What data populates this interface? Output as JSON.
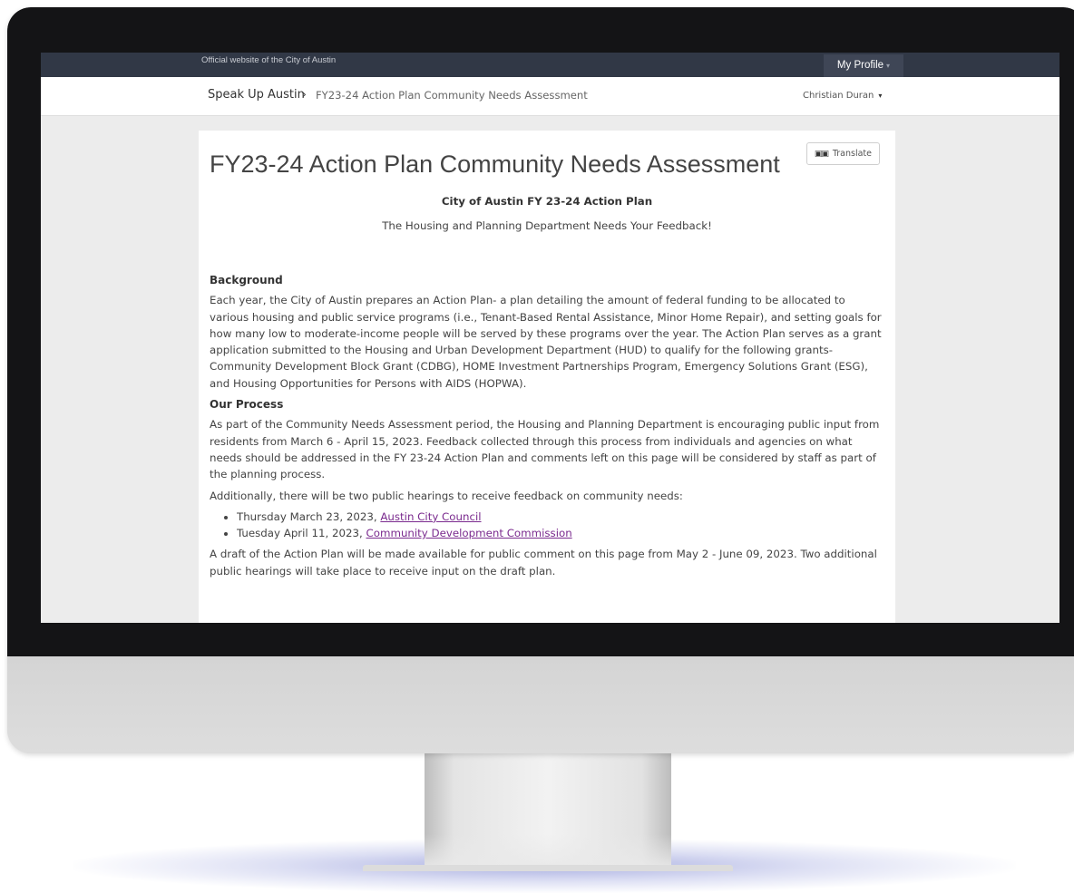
{
  "topbar": {
    "official_text": "Official website of the City of Austin",
    "profile_label": "My Profile",
    "profile_caret": "▾"
  },
  "nav": {
    "breadcrumb_home": "Speak Up Austin",
    "breadcrumb_separator": "›",
    "breadcrumb_current": "FY23-24 Action Plan Community Needs Assessment",
    "user_name": "Christian Duran",
    "user_caret": "▾"
  },
  "page": {
    "translate_icon": "▣▣",
    "translate_label": "Translate",
    "title": "FY23-24 Action Plan Community Needs Assessment",
    "subtitle": "City of Austin FY 23-24 Action Plan",
    "tagline": "The Housing and Planning Department Needs Your Feedback!",
    "background_heading": "Background",
    "background_text": "Each year, the City of Austin prepares an Action Plan- a plan detailing the amount of federal funding to be allocated to various housing and public service programs (i.e., Tenant-Based Rental Assistance, Minor Home Repair), and setting goals for how many low to moderate-income people will be served by these programs over the year. The Action Plan serves as a grant application submitted to the Housing and Urban Development Department (HUD) to qualify for the following grants- Community Development Block Grant (CDBG), HOME Investment Partnerships Program, Emergency Solutions Grant (ESG), and Housing Opportunities for Persons with AIDS (HOPWA).",
    "process_heading": "Our Process",
    "process_text": "As part of the Community Needs Assessment period, the Housing and Planning Department is encouraging public input from residents from March 6 - April 15, 2023. Feedback collected through this process from individuals and agencies on what needs should be addressed in the FY 23-24 Action Plan and comments left on this page will be considered by staff as part of the planning process.",
    "hearings_intro": "Additionally, there will be two public hearings to receive feedback on community needs:",
    "hearings": [
      {
        "date": "Thursday March 23, 2023, ",
        "link": "Austin City Council"
      },
      {
        "date": "Tuesday April 11, 2023, ",
        "link": "Community Development Commission"
      }
    ],
    "draft_text": "A draft of the Action Plan will be made available for public comment on this page from May 2 - June 09, 2023. Two additional public hearings will take place to receive input on the draft plan."
  }
}
